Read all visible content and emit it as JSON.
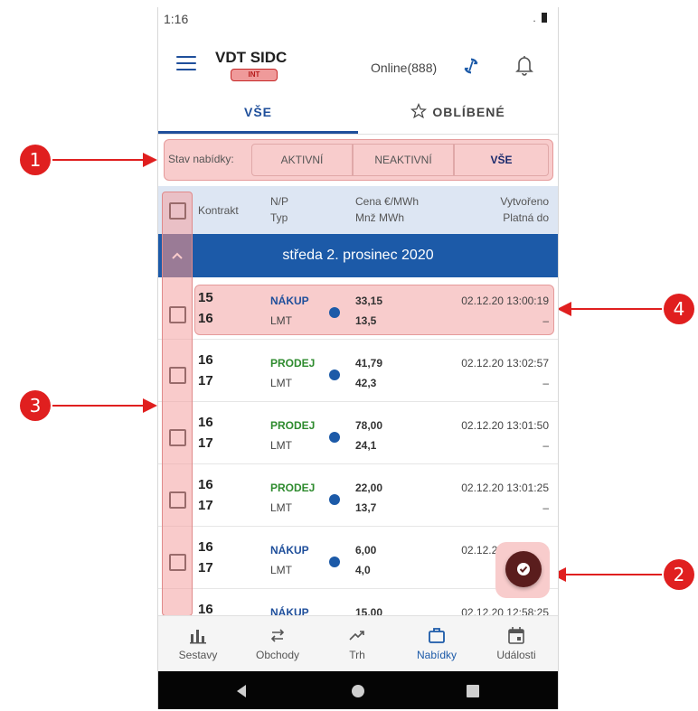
{
  "status_bar": {
    "time": "1:16"
  },
  "app_bar": {
    "title": "VDT SIDC",
    "env_badge": "INT",
    "connection": "Online(888)"
  },
  "tabs": [
    {
      "label": "VŠE"
    },
    {
      "label": "OBLÍBENÉ"
    }
  ],
  "filter": {
    "label": "Stav nabídky:",
    "options": [
      {
        "label": "AKTIVNÍ"
      },
      {
        "label": "NEAKTIVNÍ"
      },
      {
        "label": "VŠE"
      }
    ],
    "selected": "VŠE"
  },
  "columns": {
    "contract": "Kontrakt",
    "np": "N/P",
    "type": "Typ",
    "price": "Cena €/MWh",
    "qty": "Mnž MWh",
    "created": "Vytvořeno",
    "valid": "Platná do"
  },
  "group": {
    "title": "středa 2. prosinec 2020"
  },
  "rows": [
    {
      "c1": "15",
      "c2": "16",
      "side": "NÁKUP",
      "type": "LMT",
      "price": "33,15",
      "qty": "13,5",
      "created": "02.12.20 13:00:19",
      "valid": "–"
    },
    {
      "c1": "16",
      "c2": "17",
      "side": "PRODEJ",
      "type": "LMT",
      "price": "41,79",
      "qty": "42,3",
      "created": "02.12.20 13:02:57",
      "valid": "–"
    },
    {
      "c1": "16",
      "c2": "17",
      "side": "PRODEJ",
      "type": "LMT",
      "price": "78,00",
      "qty": "24,1",
      "created": "02.12.20 13:01:50",
      "valid": "–"
    },
    {
      "c1": "16",
      "c2": "17",
      "side": "PRODEJ",
      "type": "LMT",
      "price": "22,00",
      "qty": "13,7",
      "created": "02.12.20 13:01:25",
      "valid": "–"
    },
    {
      "c1": "16",
      "c2": "17",
      "side": "NÁKUP",
      "type": "LMT",
      "price": "6,00",
      "qty": "4,0",
      "created": "02.12.20 12:58:42",
      "valid": ""
    },
    {
      "c1": "16",
      "c2": "",
      "side": "NÁKUP",
      "type": "",
      "price": "15,00",
      "qty": "",
      "created": "02.12.20 12:58:25",
      "valid": ""
    }
  ],
  "bottom_nav": [
    {
      "label": "Sestavy",
      "icon": "bar-chart-icon"
    },
    {
      "label": "Obchody",
      "icon": "swap-icon"
    },
    {
      "label": "Trh",
      "icon": "trending-up-icon"
    },
    {
      "label": "Nabídky",
      "icon": "briefcase-icon",
      "active": true
    },
    {
      "label": "Události",
      "icon": "calendar-icon"
    }
  ],
  "callouts": [
    "1",
    "2",
    "3",
    "4"
  ],
  "colors": {
    "primary": "#1c5aa8",
    "buy": "#1f4f9b",
    "sell": "#2e8b2e",
    "highlight": "#f8cccc",
    "callout": "#e01f1f"
  }
}
